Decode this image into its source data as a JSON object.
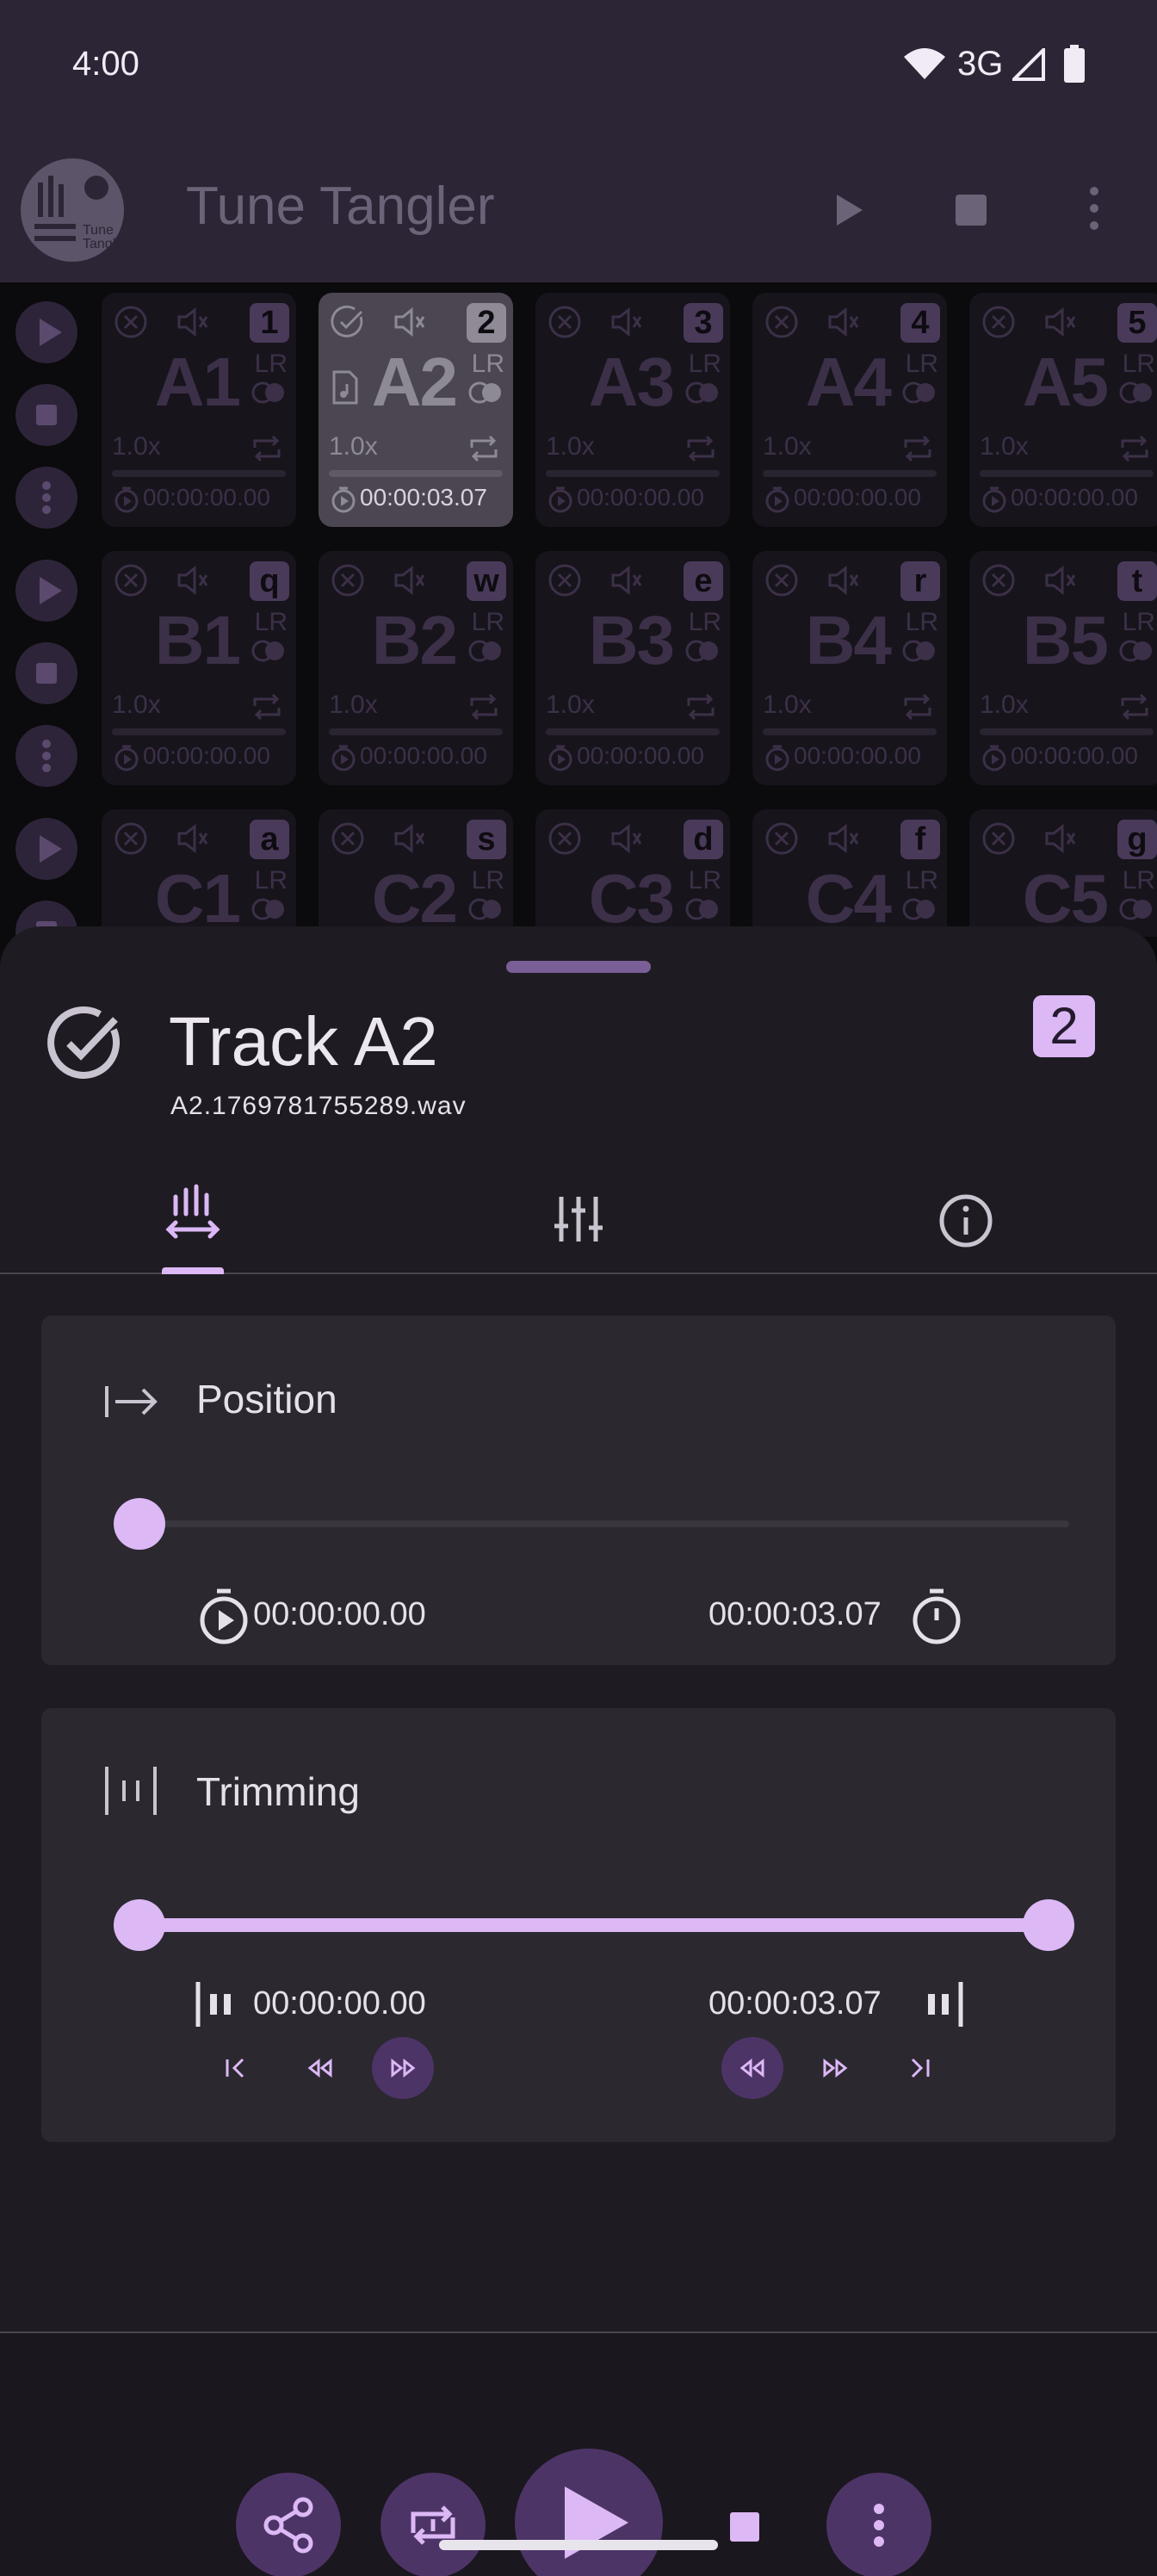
{
  "status_bar": {
    "time": "4:00",
    "network": "3G"
  },
  "app_bar": {
    "title": "Tune Tangler",
    "logo_text": "Tune Tangler",
    "actions": [
      "play-icon",
      "stop-icon",
      "more-vert-icon"
    ]
  },
  "grid": {
    "rows": [
      {
        "pads": [
          {
            "name": "A1",
            "key": "1",
            "speed": "1.0x",
            "time": "00:00:00.00"
          },
          {
            "name": "A2",
            "key": "2",
            "speed": "1.0x",
            "time": "00:00:03.07",
            "selected": true
          },
          {
            "name": "A3",
            "key": "3",
            "speed": "1.0x",
            "time": "00:00:00.00"
          },
          {
            "name": "A4",
            "key": "4",
            "speed": "1.0x",
            "time": "00:00:00.00"
          },
          {
            "name": "A5",
            "key": "5",
            "speed": "1.0x",
            "time": "00:00:00.00"
          }
        ]
      },
      {
        "pads": [
          {
            "name": "B1",
            "key": "q",
            "speed": "1.0x",
            "time": "00:00:00.00"
          },
          {
            "name": "B2",
            "key": "w",
            "speed": "1.0x",
            "time": "00:00:00.00"
          },
          {
            "name": "B3",
            "key": "e",
            "speed": "1.0x",
            "time": "00:00:00.00"
          },
          {
            "name": "B4",
            "key": "r",
            "speed": "1.0x",
            "time": "00:00:00.00"
          },
          {
            "name": "B5",
            "key": "t",
            "speed": "1.0x",
            "time": "00:00:00.00"
          }
        ]
      },
      {
        "pads": [
          {
            "name": "C1",
            "key": "a"
          },
          {
            "name": "C2",
            "key": "s"
          },
          {
            "name": "C3",
            "key": "d"
          },
          {
            "name": "C4",
            "key": "f"
          },
          {
            "name": "C5",
            "key": "g"
          }
        ]
      }
    ],
    "channel_label": "LR"
  },
  "sheet": {
    "track_title": "Track A2",
    "file_name": "A2.1769781755289.wav",
    "key_badge": "2",
    "tabs": [
      "waveform-tab",
      "mixer-tab",
      "info-tab"
    ],
    "selected_tab": 0,
    "position": {
      "title": "Position",
      "start_time": "00:00:00.00",
      "end_time": "00:00:03.07",
      "progress": 0.0
    },
    "trimming": {
      "title": "Trimming",
      "start_time": "00:00:00.00",
      "end_time": "00:00:03.07",
      "range": [
        0.0,
        1.0
      ]
    },
    "bottom_actions": [
      "share-icon",
      "repeat-one-icon",
      "play-icon",
      "stop-icon",
      "more-vert-icon"
    ]
  },
  "colors": {
    "accent": "#dcb8f5",
    "button_bg": "#4d3466",
    "appbar": "#2c2535"
  }
}
